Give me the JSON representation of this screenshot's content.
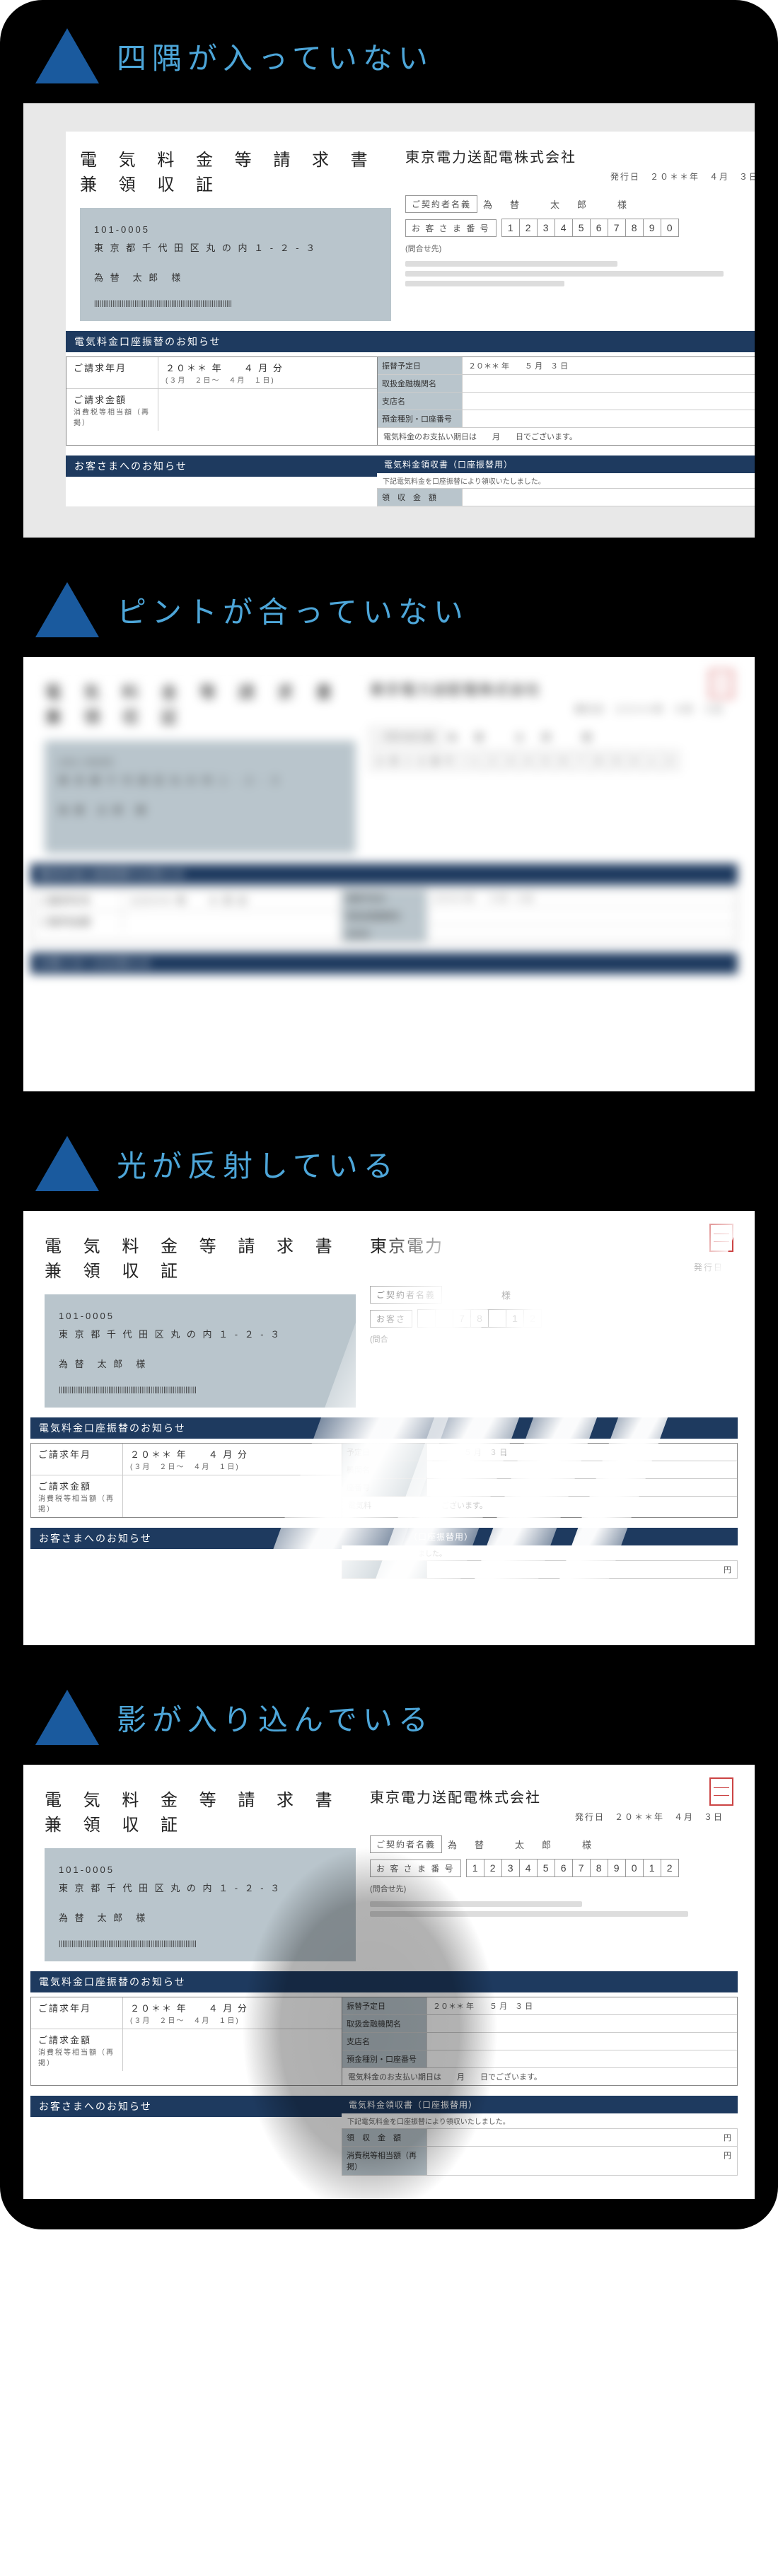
{
  "sections": [
    {
      "title": "四隅が入っていない"
    },
    {
      "title": "ピントが合っていない"
    },
    {
      "title": "光が反射している"
    },
    {
      "title": "影が入り込んでいる"
    }
  ],
  "invoice": {
    "doc_title": "電 気 料 金 等 請 求 書 兼 領 収 証",
    "company": "東京電力送配電株式会社",
    "issue_label": "発行日",
    "issue_date": "２０＊＊年　４月　３日",
    "postal": "101-0005",
    "address": "東 京 都 千 代 田 区 丸 の 内 １ - ２ - ３",
    "recipient": "為 替　太 郎　様",
    "barcode": "|||||||||||||||||||||||||||||||||||||||||||||||||||||||||||||||||||||||||||",
    "contract_label": "ご契約者名義",
    "contract_value": "為　替　　太　郎　　様",
    "custno_label": "お 客 さ ま 番 号",
    "custno_digits": [
      "1",
      "2",
      "3",
      "4",
      "5",
      "6",
      "7",
      "8",
      "9",
      "0",
      "1",
      "2"
    ],
    "inquiry_label": "(問合せ先)",
    "band1": "電気料金口座振替のお知らせ",
    "bill_month_label": "ご請求年月",
    "bill_month_value": "２０＊＊ 年　　４ 月 分",
    "bill_month_sub": "(３月　２日～　４月　１日)",
    "bill_amount_label": "ご請求金額",
    "bill_tax_note": "消費税等相当額（再掲）",
    "transfer_date_label": "振替予定日",
    "transfer_date_value": "２０＊＊ 年　　５ 月　３ 日",
    "bank_label": "取扱金融機関名",
    "branch_label": "支店名",
    "account_label": "預金種別・口座番号",
    "pay_note": "電気料金のお支払い期日は　　月　　日でございます。",
    "band2": "お客さまへのお知らせ",
    "receipt_band": "電気料金領収書（口座振替用）",
    "receipt_note": "下記電気料金を口座振替により領収いたしました。",
    "receipt_amount_label": "領　収　金　額",
    "receipt_tax_note": "消費税等相当額（再掲）",
    "yen": "円"
  }
}
